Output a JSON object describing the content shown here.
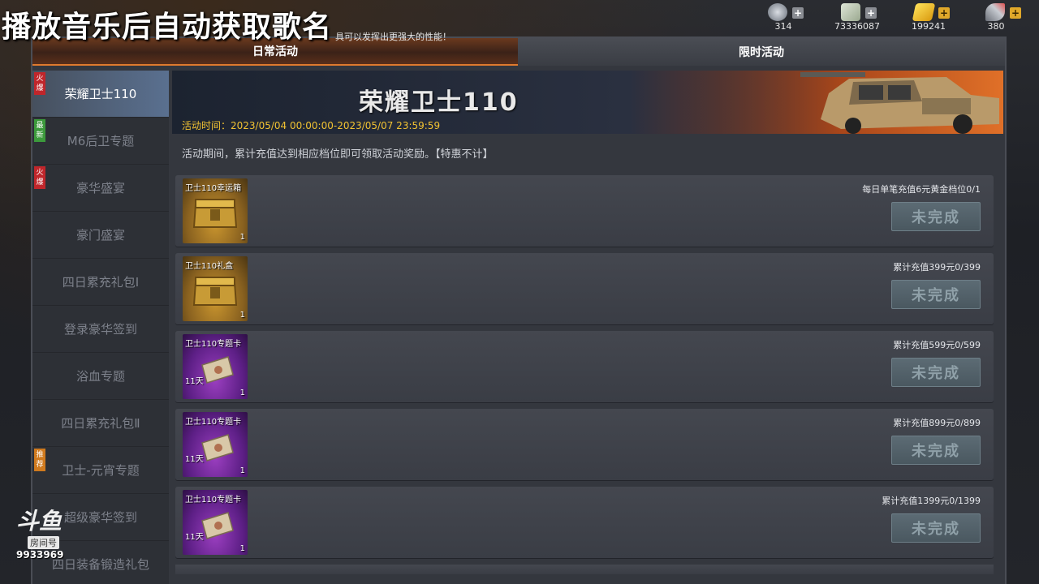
{
  "overlay": {
    "title": "播放音乐后自动获取歌名",
    "tip": "具可以发挥出更强大的性能！"
  },
  "currencies": [
    {
      "icon": "medal-icon",
      "value": "314"
    },
    {
      "icon": "cash-icon",
      "value": "73336087"
    },
    {
      "icon": "gold-bar-icon",
      "value": "199241"
    },
    {
      "icon": "rocket-icon",
      "value": "380"
    }
  ],
  "tabs": [
    {
      "label": "日常活动",
      "active": true
    },
    {
      "label": "限时活动",
      "active": false
    }
  ],
  "sidebar": {
    "items": [
      {
        "label": "荣耀卫士110",
        "badge": "火爆",
        "badge_type": "hot",
        "active": true
      },
      {
        "label": "M6后卫专题",
        "badge": "最新",
        "badge_type": "new",
        "active": false
      },
      {
        "label": "豪华盛宴",
        "badge": "火爆",
        "badge_type": "hot",
        "active": false
      },
      {
        "label": "豪门盛宴",
        "badge": "",
        "badge_type": "",
        "active": false
      },
      {
        "label": "四日累充礼包Ⅰ",
        "badge": "",
        "badge_type": "",
        "active": false
      },
      {
        "label": "登录豪华签到",
        "badge": "",
        "badge_type": "",
        "active": false
      },
      {
        "label": "浴血专题",
        "badge": "",
        "badge_type": "",
        "active": false
      },
      {
        "label": "四日累充礼包Ⅱ",
        "badge": "",
        "badge_type": "",
        "active": false
      },
      {
        "label": "卫士-元宵专题",
        "badge": "推荐",
        "badge_type": "rec",
        "active": false
      },
      {
        "label": "超级豪华签到",
        "badge": "",
        "badge_type": "",
        "active": false
      },
      {
        "label": "四日装备锻造礼包",
        "badge": "",
        "badge_type": "",
        "active": false
      }
    ]
  },
  "banner": {
    "title": "荣耀卫士110",
    "time": "活动时间：2023/05/04 00:00:00-2023/05/07 23:59:59"
  },
  "description": "活动期间，累计充值达到相应档位即可领取活动奖励。【特惠不计】",
  "rewards": [
    {
      "item_name": "卫士110幸运箱",
      "type": "gold",
      "count": "1",
      "days": "",
      "requirement": "每日单笔充值6元黄金档位0/1",
      "status": "未完成"
    },
    {
      "item_name": "卫士110礼盒",
      "type": "gold",
      "count": "1",
      "days": "",
      "requirement": "累计充值399元0/399",
      "status": "未完成"
    },
    {
      "item_name": "卫士110专题卡",
      "type": "purple",
      "count": "1",
      "days": "11天",
      "requirement": "累计充值599元0/599",
      "status": "未完成"
    },
    {
      "item_name": "卫士110专题卡",
      "type": "purple",
      "count": "1",
      "days": "11天",
      "requirement": "累计充值899元0/899",
      "status": "未完成"
    },
    {
      "item_name": "卫士110专题卡",
      "type": "purple",
      "count": "1",
      "days": "11天",
      "requirement": "累计充值1399元0/1399",
      "status": "未完成"
    }
  ],
  "watermark": {
    "logo": "斗鱼",
    "tag": "房间号",
    "room_id": "9933969"
  }
}
